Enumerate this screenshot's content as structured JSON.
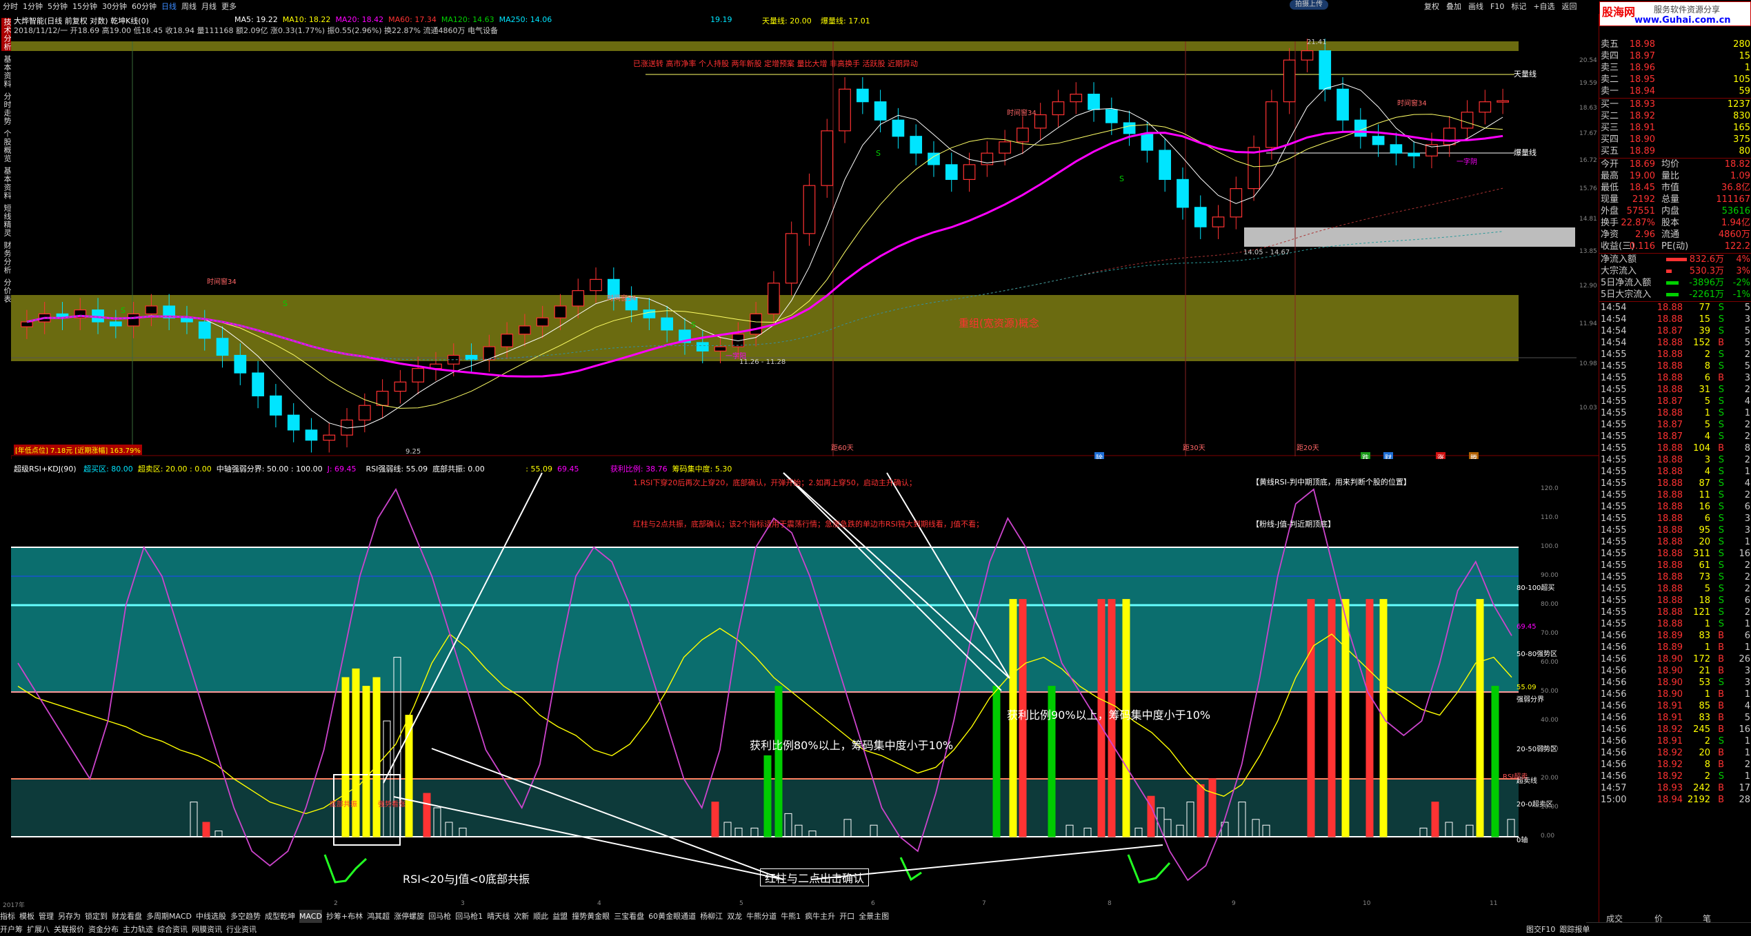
{
  "topbar": {
    "menus": [
      "分时",
      "1分钟",
      "5分钟",
      "15分钟",
      "30分钟",
      "60分钟",
      "日线",
      "周线",
      "月线",
      "更多"
    ],
    "active_menu": "日线",
    "upload_btn": "拍摄上传",
    "right_buttons": [
      "复权",
      "叠加",
      "画线",
      "F10",
      "标记",
      "+自选",
      "返回"
    ]
  },
  "brand": {
    "name": "股海网",
    "tagline": "服务软件资源分享",
    "url": "www.Guhai.com.cn"
  },
  "left_tabs": [
    "技术分析",
    "基本资料",
    "分时走势",
    "个股概览",
    "基本资料",
    "短线精灵",
    "财务分析",
    "分价表"
  ],
  "main_header": {
    "title": "大烨智能(日线 前复权 对数) 乾坤K线(0)",
    "ma5": "MA5: 19.22",
    "ma10": "MA10: 18.22",
    "ma20": "MA20: 18.42",
    "ma60": "MA60: 17.34",
    "ma120": "MA120: 14.63",
    "ma250": "MA250: 14.06",
    "val1": "19.19",
    "tianliang": "天量线: 20.00",
    "bao": "爆量线: 17.01",
    "line2": "2018/11/12/一 开18.69 高19.00 低18.45 收18.94 量111168 额2.09亿 涨0.33(1.77%) 振0.55(2.96%) 换22.87% 流通4860万 电气设备",
    "note_red": "已涨送转 高市净率 个人持股 两年新股 定增预案 量比大增 非高换手 活跃股 近期异动",
    "band_label": "重组(宽资源)概念",
    "tianliang_tag": "天量线",
    "bao_tag": "爆量线",
    "time_labels": [
      "时间窗34",
      "时间窗34",
      "时间窗34",
      "时间窗34"
    ],
    "range1": "11.26 - 11.28",
    "range2": "14.05 - 14.67",
    "low_label": "9.25",
    "high_label": "21.41",
    "bottom_left_red": "[年低点位] 7.18元 [近期涨幅] 163.79%",
    "bottom_left_date": "2017年",
    "day_labels": [
      "距60天",
      "距30天",
      "距20天"
    ],
    "s_marks": [
      "S",
      "S",
      "S",
      "S",
      "S"
    ],
    "trade_marks": [
      "一字阳",
      "一字阴"
    ],
    "price_ticks": [
      "20.54",
      "19.59",
      "18.63",
      "17.67",
      "16.72",
      "15.76",
      "14.81",
      "13.85",
      "12.90",
      "11.94",
      "10.98",
      "10.03"
    ],
    "month_badges": [
      "除",
      "跌",
      "财",
      "涨",
      "腾"
    ]
  },
  "ind_header": {
    "title": "超级RSI+KDJ(90)",
    "items": [
      "超买区: 80.00",
      "超卖区: 20.00 : 0.00",
      "中轴强弱分界: 50.00 : 100.00",
      "J: 69.45",
      "RSI强弱线: 55.09",
      "底部共振: 0.00",
      ": 55.09",
      "69.45"
    ],
    "profit": "获利比例: 38.76",
    "chip": "筹码集中度: 5.30",
    "line1": "1.RSI下穿20后再次上穿20，底部确认，开弹开始；2.如再上穿50，启动主升确认；",
    "line2": "红柱与2点共振，底部确认；该2个指标适用于震荡行情；急涨急跌的单边市RSI钝大到期线看，J值不看；",
    "note_right1": "【黄线RSI-判中期顶底，用来判断个股的位置】",
    "note_right2": "【粉线-J值-判近期顶底】",
    "ann1": "获利比例90%以上，筹码集中度小于10%",
    "ann2": "获利比例80%以上，筹码集中度小于10%",
    "ann3": "RSI<20与J值<0底部共振",
    "ann4": "红柱与二点出击确认",
    "mini_labels": [
      "底部共振",
      "强势看涨"
    ],
    "right_labels": [
      "80-100超买",
      "50-80强势区",
      "强弱分界",
      "20-50弱势区",
      "超卖线",
      "20-0超卖区",
      "0轴",
      "RSI超卖"
    ],
    "value_tags": [
      "69.45",
      "55.09"
    ],
    "ind_ticks": [
      "120.0",
      "110.0",
      "100.0",
      "90.00",
      "80.00",
      "70.00",
      "60.00",
      "50.00",
      "40.00",
      "30.00",
      "20.00",
      "10.00",
      "0.00"
    ],
    "date_ticks": [
      "2017年",
      "2",
      "3",
      "4",
      "5",
      "6",
      "7",
      "8",
      "9",
      "10",
      "11"
    ]
  },
  "quote": {
    "sells": [
      {
        "label": "卖五",
        "price": "18.98",
        "vol": "280"
      },
      {
        "label": "卖四",
        "price": "18.97",
        "vol": "15"
      },
      {
        "label": "卖三",
        "price": "18.96",
        "vol": "1"
      },
      {
        "label": "卖二",
        "price": "18.95",
        "vol": "105"
      },
      {
        "label": "卖一",
        "price": "18.94",
        "vol": "59"
      }
    ],
    "buys": [
      {
        "label": "买一",
        "price": "18.93",
        "vol": "1237"
      },
      {
        "label": "买二",
        "price": "18.92",
        "vol": "830"
      },
      {
        "label": "买三",
        "price": "18.91",
        "vol": "165"
      },
      {
        "label": "买四",
        "price": "18.90",
        "vol": "375"
      },
      {
        "label": "买五",
        "price": "18.89",
        "vol": "80"
      }
    ],
    "stats": [
      [
        "今开",
        "18.69",
        "均价",
        "18.82"
      ],
      [
        "最高",
        "19.00",
        "量比",
        "1.09"
      ],
      [
        "最低",
        "18.45",
        "市值",
        "36.8亿"
      ],
      [
        "现量",
        "2192",
        "总量",
        "111167"
      ],
      [
        "外盘",
        "57551",
        "内盘",
        "53616"
      ],
      [
        "换手",
        "22.87%",
        "股本",
        "1.94亿"
      ],
      [
        "净资",
        "2.96",
        "流通",
        "4860万"
      ],
      [
        "收益(三)",
        "0.116",
        "PE(动)",
        "122.2"
      ]
    ],
    "flows": [
      [
        "净流入额",
        "832.6万",
        "4%"
      ],
      [
        "大宗流入",
        "530.3万",
        "3%"
      ],
      [
        "5日净流入额",
        "-3896万",
        "-2%"
      ],
      [
        "5日大宗流入",
        "-2261万",
        "-1%"
      ]
    ],
    "ticks": [
      [
        "14:54",
        "18.88",
        "77",
        "S",
        "5"
      ],
      [
        "14:54",
        "18.88",
        "15",
        "S",
        "3"
      ],
      [
        "14:54",
        "18.87",
        "39",
        "S",
        "5"
      ],
      [
        "14:54",
        "18.88",
        "152",
        "B",
        "5"
      ],
      [
        "14:55",
        "18.88",
        "2",
        "S",
        "2"
      ],
      [
        "14:55",
        "18.88",
        "8",
        "S",
        "5"
      ],
      [
        "14:55",
        "18.88",
        "6",
        "B",
        "3"
      ],
      [
        "14:55",
        "18.88",
        "31",
        "S",
        "2"
      ],
      [
        "14:55",
        "18.87",
        "5",
        "S",
        "4"
      ],
      [
        "14:55",
        "18.88",
        "1",
        "S",
        "1"
      ],
      [
        "14:55",
        "18.87",
        "5",
        "S",
        "2"
      ],
      [
        "14:55",
        "18.87",
        "4",
        "S",
        "2"
      ],
      [
        "14:55",
        "18.88",
        "104",
        "B",
        "8"
      ],
      [
        "14:55",
        "18.88",
        "3",
        "S",
        "2"
      ],
      [
        "14:55",
        "18.88",
        "4",
        "S",
        "1"
      ],
      [
        "14:55",
        "18.88",
        "87",
        "S",
        "4"
      ],
      [
        "14:55",
        "18.88",
        "11",
        "S",
        "2"
      ],
      [
        "14:55",
        "18.88",
        "16",
        "S",
        "6"
      ],
      [
        "14:55",
        "18.88",
        "6",
        "S",
        "3"
      ],
      [
        "14:55",
        "18.88",
        "95",
        "S",
        "3"
      ],
      [
        "14:55",
        "18.88",
        "20",
        "S",
        "1"
      ],
      [
        "14:55",
        "18.88",
        "311",
        "S",
        "16"
      ],
      [
        "14:55",
        "18.88",
        "61",
        "S",
        "2"
      ],
      [
        "14:55",
        "18.88",
        "73",
        "S",
        "2"
      ],
      [
        "14:55",
        "18.88",
        "5",
        "S",
        "2"
      ],
      [
        "14:55",
        "18.88",
        "18",
        "S",
        "6"
      ],
      [
        "14:55",
        "18.88",
        "121",
        "S",
        "2"
      ],
      [
        "14:55",
        "18.88",
        "1",
        "S",
        "1"
      ],
      [
        "14:56",
        "18.89",
        "83",
        "B",
        "6"
      ],
      [
        "14:56",
        "18.89",
        "1",
        "B",
        "1"
      ],
      [
        "14:56",
        "18.90",
        "172",
        "B",
        "26"
      ],
      [
        "14:56",
        "18.90",
        "21",
        "B",
        "3"
      ],
      [
        "14:56",
        "18.90",
        "53",
        "S",
        "3"
      ],
      [
        "14:56",
        "18.90",
        "1",
        "B",
        "1"
      ],
      [
        "14:56",
        "18.91",
        "85",
        "B",
        "4"
      ],
      [
        "14:56",
        "18.91",
        "83",
        "B",
        "5"
      ],
      [
        "14:56",
        "18.92",
        "245",
        "B",
        "16"
      ],
      [
        "14:56",
        "18.91",
        "2",
        "S",
        "1"
      ],
      [
        "14:56",
        "18.92",
        "20",
        "B",
        "1"
      ],
      [
        "14:56",
        "18.92",
        "8",
        "B",
        "2"
      ],
      [
        "14:56",
        "18.92",
        "2",
        "S",
        "1"
      ],
      [
        "14:57",
        "18.93",
        "242",
        "B",
        "17"
      ],
      [
        "15:00",
        "18.94",
        "2192",
        "B",
        "28"
      ]
    ],
    "tick_header": [
      "成交",
      "价",
      "笔"
    ]
  },
  "bottombar": {
    "tabs": [
      "指标",
      "模板",
      "管理",
      "另存为",
      "锁定到",
      "财龙看盘",
      "多周期MACD",
      "中线选股",
      "多空趋势",
      "成型乾坤",
      "MACD",
      "抄筹+布林",
      "鸿其超",
      "涨停螺旋",
      "回马枪",
      "回马枪1",
      "晴天线",
      "次新",
      "顺此",
      "益盟",
      "撞势黄金眼",
      "三宝看盘",
      "60黄金眼通道",
      "杨柳江",
      "双龙",
      "牛熊分道",
      "牛熊1",
      "疯牛主升",
      "开口",
      "全景主图"
    ],
    "active_tab": "MACD",
    "row2": [
      "开户筹",
      "扩展八",
      "关联报价",
      "资金分布",
      "主力轨迹",
      "综合资讯",
      "网膜资讯",
      "行业资讯"
    ],
    "right": [
      "图交F10",
      "跟踪报单"
    ]
  },
  "chart_data": [
    {
      "type": "candlestick",
      "title": "大烨智能(日线 前复权 对数) 乾坤K线(0)",
      "ylim": [
        9.25,
        21.41
      ],
      "grid": false,
      "closes": [
        12.0,
        12.2,
        12.1,
        12.3,
        12.0,
        11.9,
        12.2,
        12.4,
        12.1,
        12.0,
        11.6,
        11.2,
        10.8,
        10.3,
        9.9,
        9.6,
        9.4,
        9.5,
        9.8,
        10.1,
        10.4,
        10.6,
        10.9,
        11.0,
        11.2,
        11.1,
        11.4,
        11.7,
        11.9,
        12.1,
        12.4,
        12.8,
        13.1,
        12.6,
        12.3,
        12.1,
        11.8,
        11.5,
        11.3,
        11.4,
        11.7,
        12.2,
        13.0,
        14.4,
        15.9,
        17.8,
        19.4,
        18.9,
        18.2,
        17.6,
        17.0,
        16.6,
        16.1,
        16.6,
        17.0,
        17.4,
        17.9,
        18.4,
        18.9,
        19.2,
        18.6,
        18.1,
        17.7,
        17.1,
        16.1,
        15.2,
        14.6,
        14.9,
        15.8,
        17.2,
        18.9,
        20.6,
        21.0,
        19.4,
        18.2,
        17.6,
        17.3,
        17.0,
        16.9,
        17.3,
        17.9,
        18.5,
        18.9,
        18.94
      ],
      "ma_series": [
        {
          "name": "MA5",
          "value": 19.22
        },
        {
          "name": "MA10",
          "value": 18.22
        },
        {
          "name": "MA20",
          "value": 18.42
        },
        {
          "name": "MA60",
          "value": 17.34
        },
        {
          "name": "MA120",
          "value": 14.63
        },
        {
          "name": "MA250",
          "value": 14.06
        }
      ],
      "annotations": [
        "天量线 20.00",
        "爆量线 17.01"
      ]
    },
    {
      "type": "line",
      "title": "超级RSI+KDJ(90)",
      "ylim": [
        0,
        120
      ],
      "series": [
        {
          "name": "RSI",
          "values": [
            52,
            48,
            46,
            44,
            42,
            40,
            38,
            35,
            33,
            30,
            28,
            25,
            20,
            16,
            12,
            10,
            8,
            10,
            14,
            18,
            25,
            32,
            45,
            60,
            70,
            65,
            58,
            52,
            48,
            42,
            38,
            35,
            30,
            28,
            32,
            40,
            50,
            62,
            68,
            72,
            68,
            62,
            55,
            50,
            45,
            40,
            35,
            30,
            28,
            25,
            22,
            24,
            30,
            38,
            48,
            55,
            60,
            62,
            58,
            52,
            48,
            45,
            40,
            36,
            30,
            22,
            16,
            14,
            18,
            28,
            40,
            55,
            66,
            70,
            64,
            58,
            52,
            48,
            44,
            42,
            50,
            60,
            62,
            55.09
          ]
        },
        {
          "name": "J",
          "values": [
            60,
            50,
            40,
            30,
            20,
            40,
            80,
            100,
            90,
            70,
            50,
            30,
            10,
            -5,
            -10,
            -5,
            10,
            30,
            60,
            90,
            110,
            120,
            105,
            90,
            70,
            50,
            30,
            20,
            10,
            25,
            60,
            90,
            100,
            95,
            80,
            60,
            40,
            20,
            10,
            30,
            70,
            100,
            110,
            105,
            90,
            70,
            50,
            30,
            10,
            0,
            -5,
            15,
            40,
            70,
            95,
            110,
            100,
            80,
            60,
            50,
            40,
            30,
            20,
            10,
            -5,
            -15,
            -10,
            5,
            25,
            55,
            90,
            115,
            120,
            95,
            70,
            50,
            40,
            35,
            40,
            60,
            85,
            95,
            80,
            69.45
          ]
        }
      ],
      "reference_lines": [
        {
          "name": "超买区",
          "value": 80
        },
        {
          "name": "强弱分界",
          "value": 50
        },
        {
          "name": "超卖区",
          "value": 20
        },
        {
          "name": "0轴",
          "value": 0
        }
      ]
    }
  ],
  "colors": {
    "up": "#ff3232",
    "down": "#00e5ff",
    "ma_magenta": "#ff00ff",
    "rsi": "#ffff00",
    "j": "#cc44cc",
    "band_olive": "#666600",
    "teal": "#006b6b"
  }
}
